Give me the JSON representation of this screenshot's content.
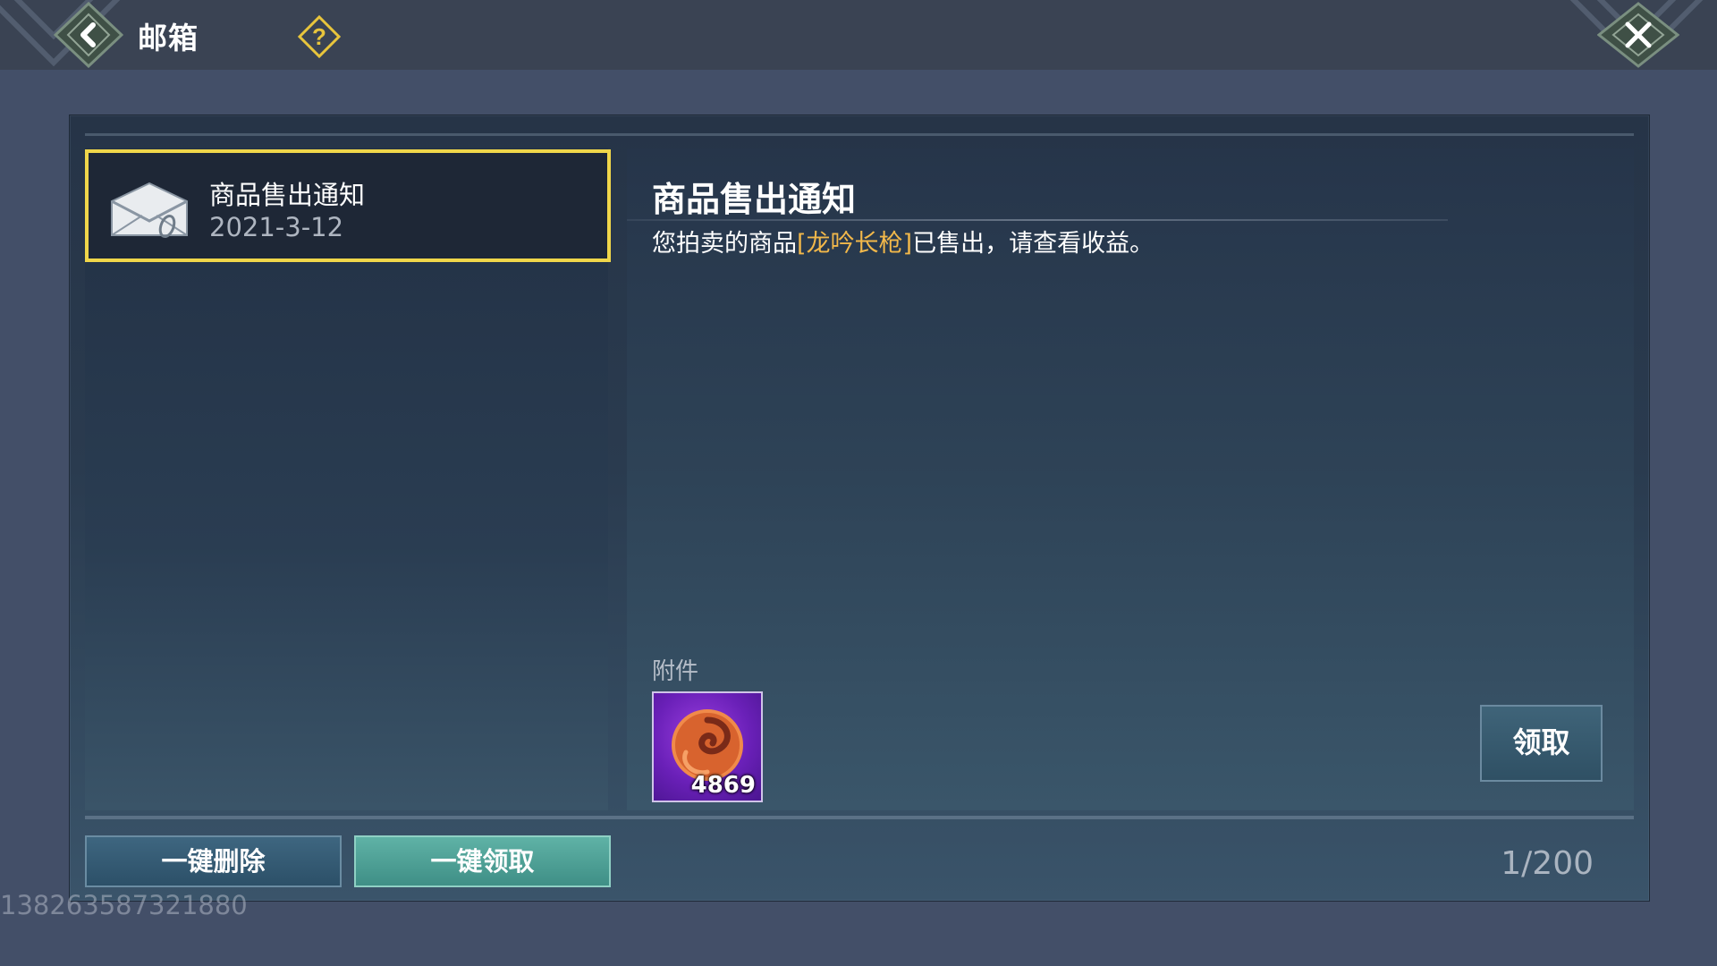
{
  "header": {
    "title": "邮箱",
    "back_icon": "back-arrow-icon",
    "help_icon": "question-mark-icon",
    "close_icon": "close-x-icon"
  },
  "mail_list": [
    {
      "title": "商品售出通知",
      "date": "2021-3-12",
      "icon": "envelope-icon",
      "selected": true
    }
  ],
  "detail": {
    "title": "商品售出通知",
    "body_prefix": "您拍卖的商品",
    "item_name": "[龙吟长枪]",
    "body_suffix": "已售出，请查看收益。",
    "attachment_label": "附件",
    "attachment": {
      "icon": "currency-swirl-icon",
      "count": "4869"
    },
    "claim_button": "领取"
  },
  "footer": {
    "delete_all": "一键删除",
    "claim_all": "一键领取",
    "counter": "1/200"
  },
  "watermark_uid": "138263587321880",
  "colors": {
    "highlight": "#f2b84a",
    "selected_border": "#f0d64a",
    "claim_all_bg": "#4fa196"
  }
}
